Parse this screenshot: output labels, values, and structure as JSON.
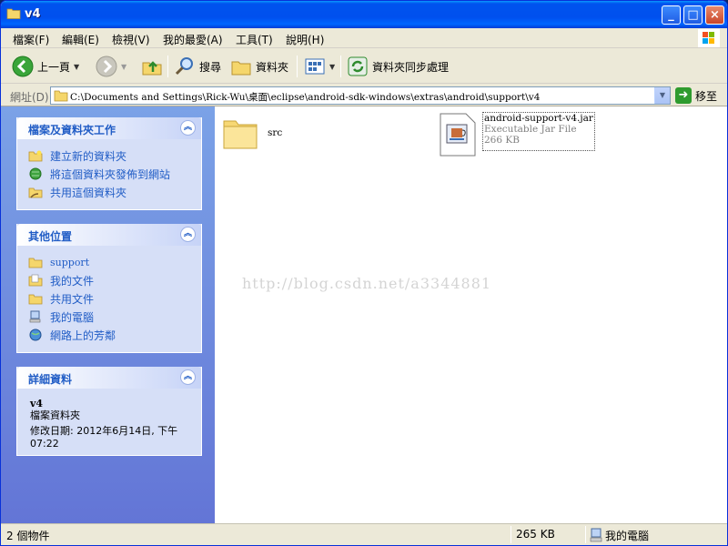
{
  "window": {
    "title": "v4",
    "minimize": "_",
    "maximize": "□",
    "close": "×"
  },
  "menu": [
    "檔案(F)",
    "編輯(E)",
    "檢視(V)",
    "我的最愛(A)",
    "工具(T)",
    "說明(H)"
  ],
  "toolbar": {
    "back": "上一頁",
    "search": "搜尋",
    "folders": "資料夾",
    "sync": "資料夾同步處理"
  },
  "address": {
    "label": "網址(D)",
    "path": "C:\\Documents and Settings\\Rick-Wu\\桌面\\eclipse\\android-sdk-windows\\extras\\android\\support\\v4",
    "go": "移至"
  },
  "tasks": {
    "title": "檔案及資料夾工作",
    "items": [
      "建立新的資料夾",
      "將這個資料夾發佈到網站",
      "共用這個資料夾"
    ]
  },
  "places": {
    "title": "其他位置",
    "items": [
      "support",
      "我的文件",
      "共用文件",
      "我的電腦",
      "網路上的芳鄰"
    ]
  },
  "details": {
    "title": "詳細資料",
    "name": "v4",
    "type": "檔案資料夾",
    "modified": "修改日期: 2012年6月14日, 下午 07:22"
  },
  "files": [
    {
      "name": "src"
    },
    {
      "name": "android-support-v4.jar",
      "type": "Executable Jar File",
      "size": "266 KB"
    }
  ],
  "watermark": "http://blog.csdn.net/a3344881",
  "status": {
    "count": "2 個物件",
    "size": "265 KB",
    "location": "我的電腦"
  },
  "colors": {
    "titlebar": "#0053ee",
    "link": "#215dc6",
    "taskpane": "#6e8ddf"
  }
}
